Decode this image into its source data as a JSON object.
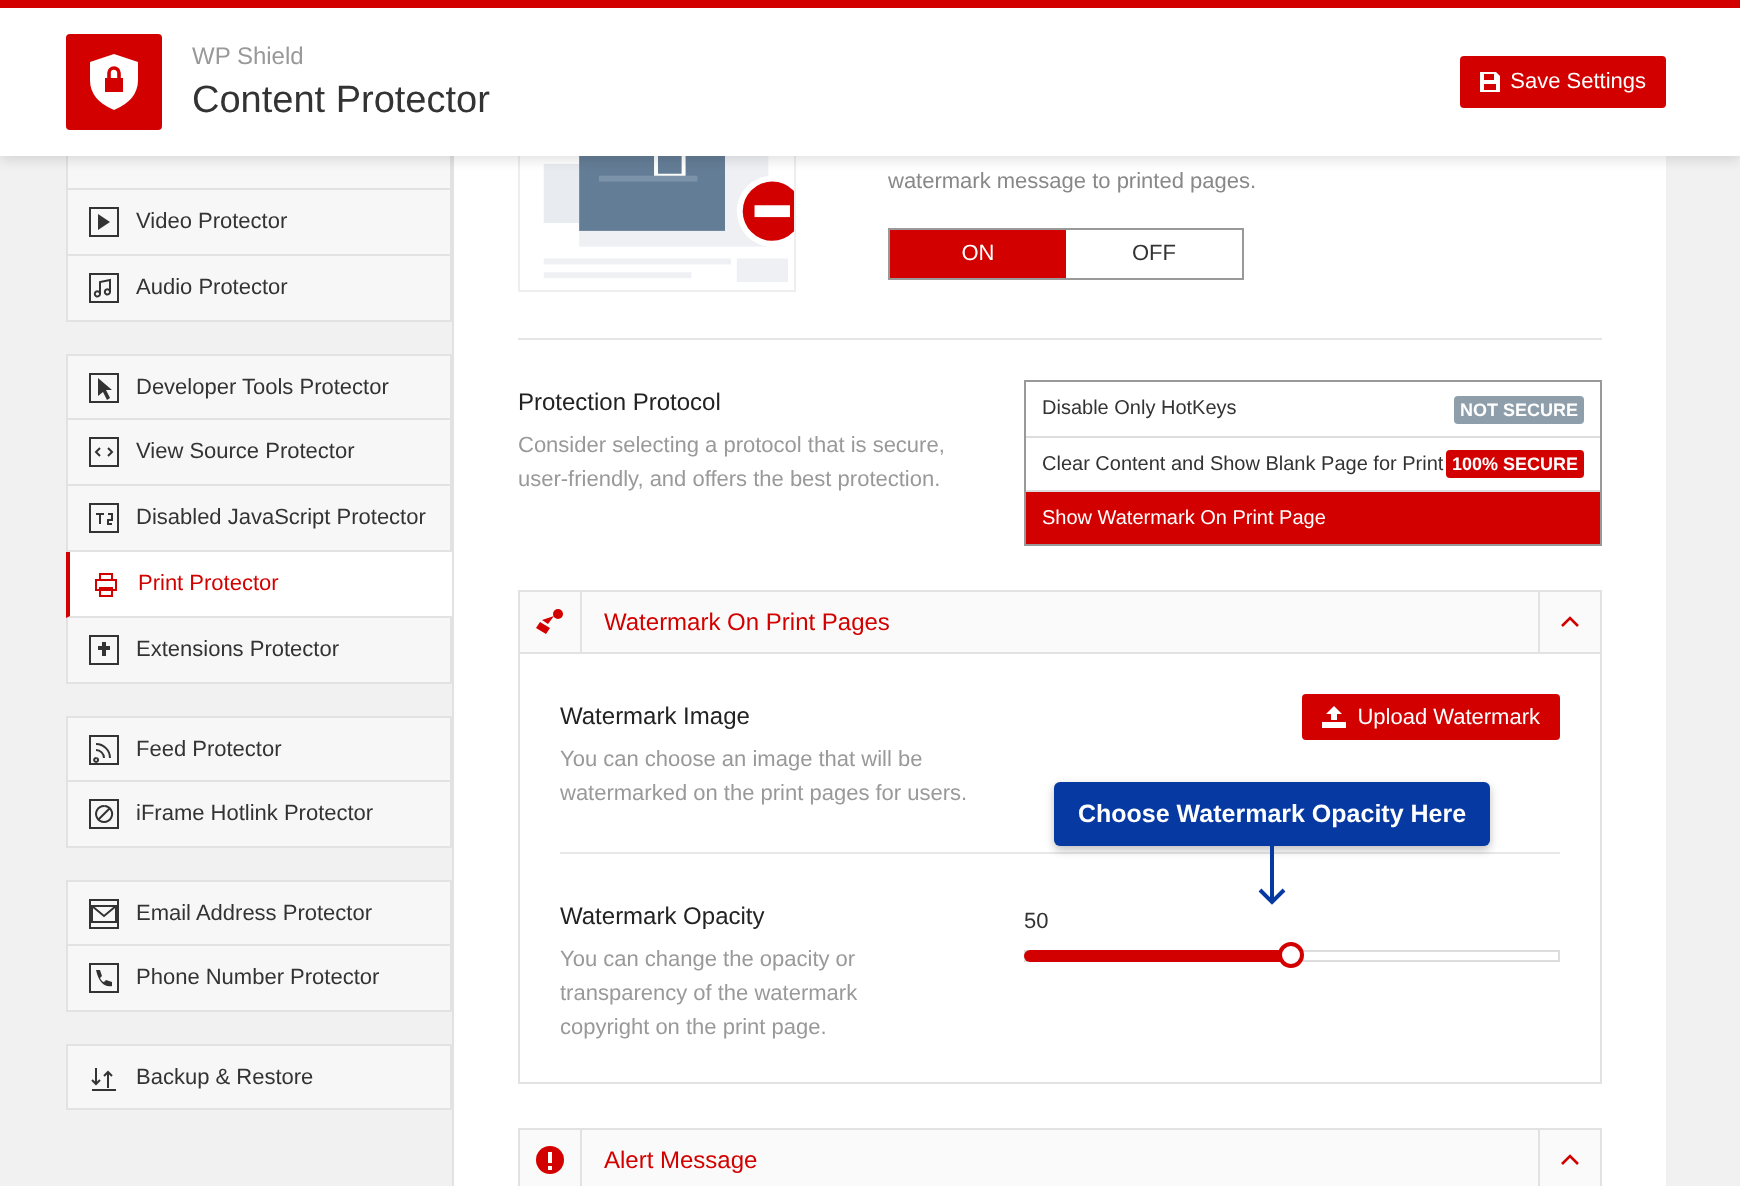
{
  "header": {
    "brand": "WP Shield",
    "title": "Content Protector",
    "save_button": "Save Settings"
  },
  "sidebar": {
    "groups": [
      [
        {
          "label": "Video Protector",
          "selected": false
        },
        {
          "label": "Audio Protector",
          "selected": false
        }
      ],
      [
        {
          "label": "Developer Tools Protector",
          "selected": false
        },
        {
          "label": "View Source Protector",
          "selected": false
        },
        {
          "label": "Disabled JavaScript Protector",
          "selected": false
        },
        {
          "label": "Print Protector",
          "selected": true
        },
        {
          "label": "Extensions Protector",
          "selected": false
        }
      ],
      [
        {
          "label": "Feed Protector",
          "selected": false
        },
        {
          "label": "iFrame Hotlink Protector",
          "selected": false
        }
      ],
      [
        {
          "label": "Email Address Protector",
          "selected": false
        },
        {
          "label": "Phone Number Protector",
          "selected": false
        }
      ],
      [
        {
          "label": "Backup & Restore",
          "selected": false
        }
      ]
    ]
  },
  "intro": {
    "text": "watermark message to printed pages.",
    "toggle": [
      {
        "label": "ON",
        "selected": true
      },
      {
        "label": "OFF",
        "selected": false
      }
    ]
  },
  "protocol": {
    "title": "Protection Protocol",
    "description": "Consider selecting a protocol that is secure, user-friendly, and offers the best protection.",
    "options": [
      {
        "label": "Disable Only HotKeys",
        "badge": {
          "text": "NOT SECURE",
          "kind": "not_secure"
        },
        "selected": false
      },
      {
        "label": "Clear Content and Show Blank Page for Print",
        "badge": {
          "text": "100% SECURE",
          "kind": "secure"
        },
        "selected": false
      },
      {
        "label": "Show Watermark On Print Page",
        "selected": true
      }
    ]
  },
  "sections": [
    {
      "title": "Watermark On Print Pages",
      "expanded": true,
      "fields": [
        {
          "kind": "upload",
          "label": "Watermark Image",
          "description": "You can choose an image that will be watermarked on the print pages for users.",
          "button": "Upload Watermark"
        },
        {
          "kind": "slider",
          "label": "Watermark Opacity",
          "description": "You can change the opacity or transparency of the watermark copyright on the print page.",
          "reading": "50",
          "level": 0.5,
          "tooltip": "Choose Watermark Opacity Here"
        }
      ]
    },
    {
      "title": "Alert Message",
      "expanded": true
    }
  ]
}
